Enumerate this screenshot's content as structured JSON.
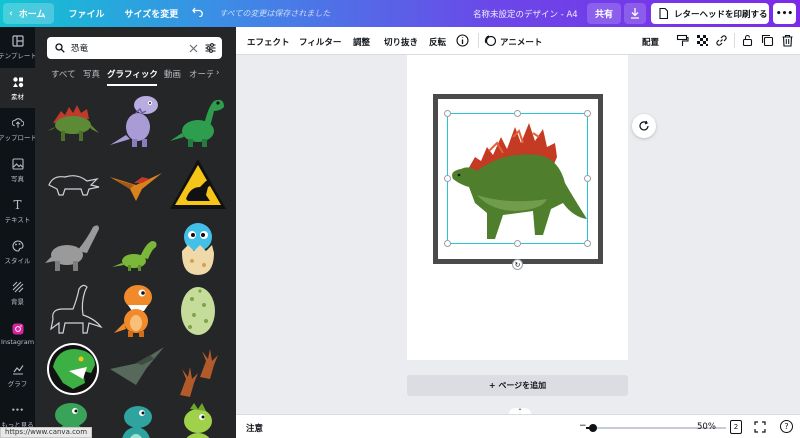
{
  "topbar": {
    "home_label": "ホーム",
    "file_label": "ファイル",
    "resize_label": "サイズを変更",
    "saved_status": "すべての変更は保存されました",
    "design_title": "名称未設定のデザイン - A4",
    "share_label": "共有",
    "print_label": "レターヘッドを印刷する",
    "more_label": "•••"
  },
  "leftnav": {
    "items": [
      {
        "label": "テンプレート",
        "icon": "template-icon"
      },
      {
        "label": "素材",
        "icon": "elements-icon"
      },
      {
        "label": "アップロード",
        "icon": "upload-icon"
      },
      {
        "label": "写真",
        "icon": "photos-icon"
      },
      {
        "label": "テキスト",
        "icon": "text-icon"
      },
      {
        "label": "スタイル",
        "icon": "styles-icon"
      },
      {
        "label": "背景",
        "icon": "background-icon"
      },
      {
        "label": "Instagram",
        "icon": "instagram-icon"
      },
      {
        "label": "グラフ",
        "icon": "chart-icon"
      },
      {
        "label": "もっと見る",
        "icon": "more-icon"
      }
    ]
  },
  "panel": {
    "search_value": "恐竜",
    "tabs": [
      "すべて",
      "写真",
      "グラフィック",
      "動画",
      "オーディオ"
    ],
    "active_tab": "グラフィック"
  },
  "context_toolbar": {
    "effects": "エフェクト",
    "filter": "フィルター",
    "adjust": "調整",
    "crop": "切り抜き",
    "flip": "反転",
    "animate": "アニメート",
    "position": "配置"
  },
  "canvas": {
    "add_page_label": "+ ページを追加"
  },
  "bottombar": {
    "notes_label": "注意",
    "zoom": "50%",
    "page_count": "2",
    "help": "?"
  },
  "status_url": "https://www.canva.com"
}
